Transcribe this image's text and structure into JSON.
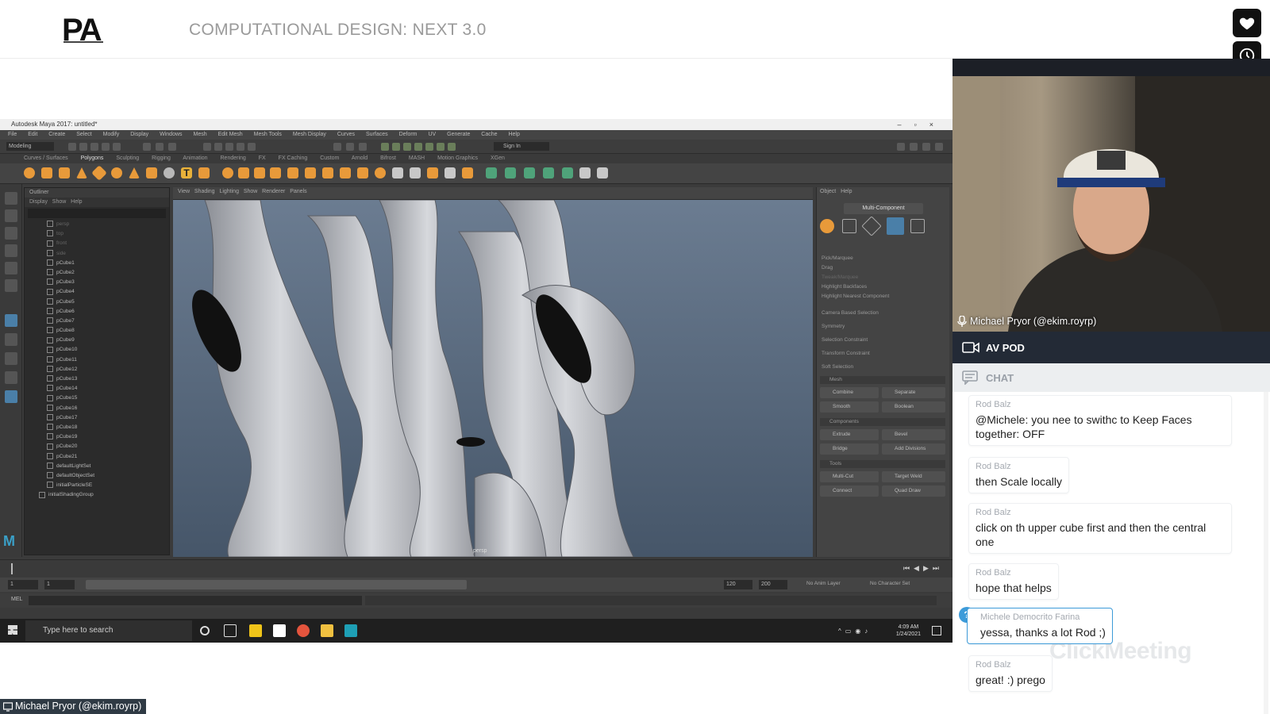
{
  "header": {
    "logo": "PA",
    "title": "COMPUTATIONAL DESIGN: NEXT 3.0"
  },
  "side_buttons": [
    {
      "icon": "heart-icon"
    },
    {
      "icon": "clock-icon"
    }
  ],
  "maya": {
    "window_title": "Autodesk Maya 2017: untitled*",
    "menu": [
      "File",
      "Edit",
      "Create",
      "Select",
      "Modify",
      "Display",
      "Windows",
      "Mesh",
      "Edit Mesh",
      "Mesh Tools",
      "Mesh Display",
      "Curves",
      "Surfaces",
      "Deform",
      "UV",
      "Generate",
      "Cache",
      "Help"
    ],
    "mode": "Modeling",
    "shelf_tabs": [
      "Curves / Surfaces",
      "Polygons",
      "Sculpting",
      "Rigging",
      "Animation",
      "Rendering",
      "FX",
      "FX Caching",
      "Custom",
      "Arnold",
      "Bifrost",
      "MASH",
      "Motion Graphics",
      "XGen"
    ],
    "sign_in": "Sign In",
    "outliner": {
      "title": "Outliner",
      "menu": [
        "Display",
        "Show",
        "Help"
      ],
      "items": [
        "persp",
        "top",
        "front",
        "side",
        "pCube1",
        "pCube2",
        "pCube3",
        "pCube4",
        "pCube5",
        "pCube6",
        "pCube7",
        "pCube8",
        "pCube9",
        "pCube10",
        "pCube11",
        "pCube12",
        "pCube13",
        "pCube14",
        "pCube15",
        "pCube16",
        "pCube17",
        "pCube18",
        "pCube19",
        "pCube20",
        "pCube21",
        "defaultLightSet",
        "defaultObjectSet",
        "initialParticleSE",
        "initialShadingGroup"
      ]
    },
    "viewport_menu": [
      "View",
      "Shading",
      "Lighting",
      "Show",
      "Renderer",
      "Panels"
    ],
    "viewport_label": "persp",
    "toolkit": {
      "menu": [
        "Object",
        "Help"
      ],
      "tab": "Multi-Component",
      "options": [
        "Pick/Marquee",
        "Drag",
        "Tweak/Marquee",
        "Highlight Backfaces",
        "Highlight Nearest Component"
      ],
      "settings": [
        "Camera Based Selection",
        "Symmetry",
        "Selection Constraint",
        "Transform Constraint",
        "Soft Selection"
      ],
      "mesh_header": "Mesh",
      "mesh_tools": [
        "Combine",
        "Separate",
        "Smooth",
        "Boolean"
      ],
      "components_header": "Components",
      "component_tools": [
        "Extrude",
        "Bevel",
        "Bridge",
        "Add Divisions"
      ],
      "tools_header": "Tools",
      "tools": [
        "Multi-Cut",
        "Target Weld",
        "Connect",
        "Quad Draw"
      ]
    },
    "range": {
      "start": "1",
      "end": "120",
      "end2": "200",
      "anim_layer": "No Anim Layer",
      "char_set": "No Character Set"
    },
    "cmd_label": "MEL",
    "taskbar": {
      "search_placeholder": "Type here to search",
      "time": "4:09 AM",
      "date": "1/24/2021"
    }
  },
  "webcam": {
    "presenter": "Michael Pryor (@ekim.royrp)"
  },
  "panel": {
    "av_pod": "AV POD",
    "chat": "CHAT",
    "watermark": "ClickMeeting",
    "messages": [
      {
        "author": "Rod Balz",
        "text": "@Michele: you nee to swithc to Keep Faces together: OFF"
      },
      {
        "author": "Rod Balz",
        "text": "then Scale locally"
      },
      {
        "author": "Rod Balz",
        "text": "click on th upper cube first and then the central one"
      },
      {
        "author": "Rod Balz",
        "text": "hope that helps"
      },
      {
        "author": "Michele Democrito Farina",
        "text": "yessa, thanks a lot Rod ;)",
        "question": "?"
      },
      {
        "author": "Rod Balz",
        "text": "great! :) prego"
      }
    ]
  },
  "bottom_label": "Michael Pryor (@ekim.royrp)"
}
